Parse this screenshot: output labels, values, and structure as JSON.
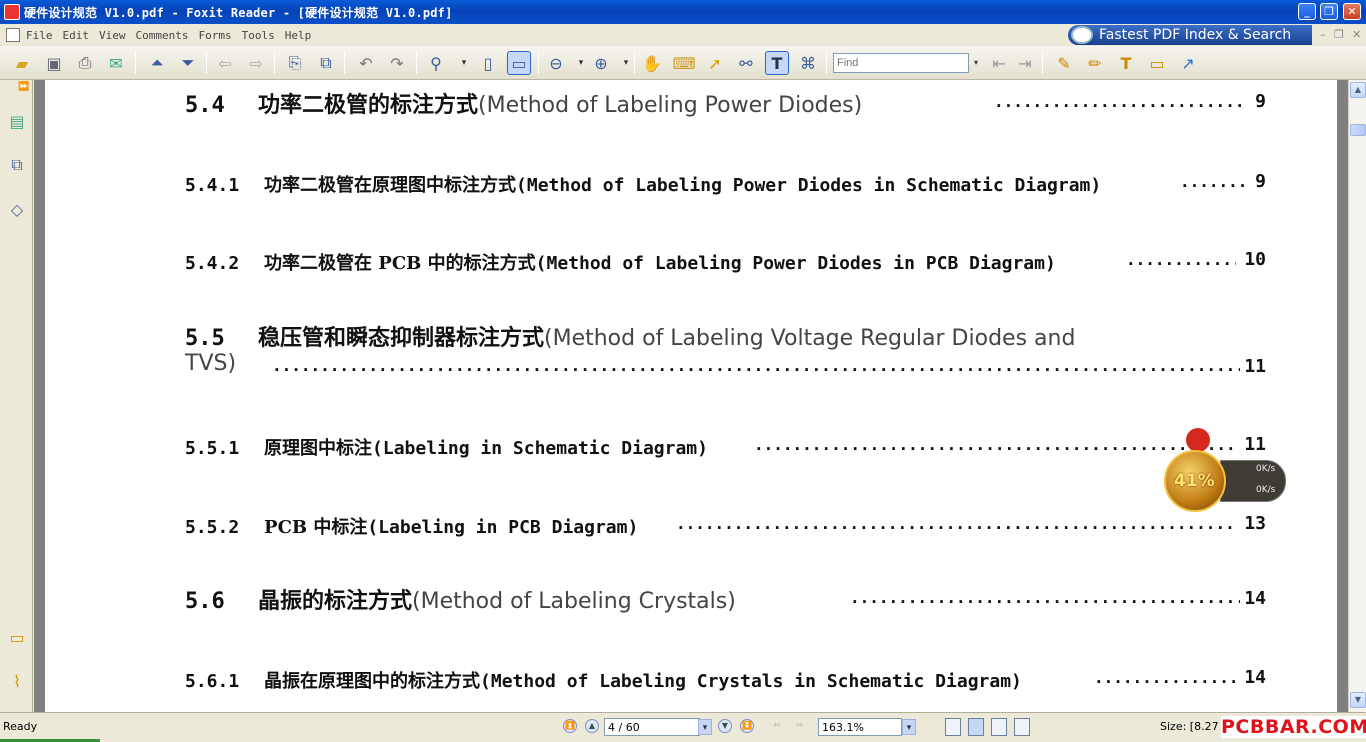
{
  "window": {
    "title": "硬件设计规范 V1.0.pdf - Foxit Reader - [硬件设计规范 V1.0.pdf]",
    "minimize": "_",
    "restore": "❐",
    "close": "✕"
  },
  "menu": {
    "items": [
      "File",
      "Edit",
      "View",
      "Comments",
      "Forms",
      "Tools",
      "Help"
    ],
    "ad_text": "Fastest PDF Index & Search"
  },
  "toolbar": {
    "find_placeholder": "Find"
  },
  "document": {
    "entries": [
      {
        "num": "5.4",
        "cn": "功率二极管的标注方式",
        "en": "(Method of Labeling Power Diodes)",
        "page": "9",
        "level": 2
      },
      {
        "num": "5.4.1",
        "cn": "功率二极管在原理图中标注方式",
        "en": "(Method of Labeling Power Diodes in Schematic Diagram)",
        "page": "9",
        "level": 3
      },
      {
        "num": "5.4.2",
        "cn": "功率二极管在 PCB 中的标注方式",
        "en": "(Method of Labeling Power Diodes in PCB Diagram)",
        "page": "10",
        "level": 3
      },
      {
        "num": "5.5",
        "cn": "稳压管和瞬态抑制器标注方式",
        "en": "(Method of Labeling Voltage Regular Diodes and",
        "en2": "TVS)",
        "page": "11",
        "level": 2
      },
      {
        "num": "5.5.1",
        "cn": "原理图中标注",
        "en": "(Labeling in Schematic Diagram)",
        "page": "11",
        "level": 3
      },
      {
        "num": "5.5.2",
        "cn": "PCB 中标注",
        "en": "(Labeling in PCB Diagram)",
        "page": "13",
        "level": 3
      },
      {
        "num": "5.6",
        "cn": "晶振的标注方式",
        "en": "(Method of Labeling Crystals)",
        "page": "14",
        "level": 2
      },
      {
        "num": "5.6.1",
        "cn": "晶振在原理图中的标注方式",
        "en": "(Method of Labeling Crystals in Schematic Diagram)",
        "page": "14",
        "level": 3
      }
    ]
  },
  "status": {
    "ready": "Ready",
    "page_box": "4 / 60",
    "zoom": "163.1%",
    "size": "Size: [8.27",
    "watermark": "PCBBAR.COM"
  },
  "net_widget": {
    "percent": "41%",
    "up": "0K/s",
    "down": "0K/s"
  }
}
